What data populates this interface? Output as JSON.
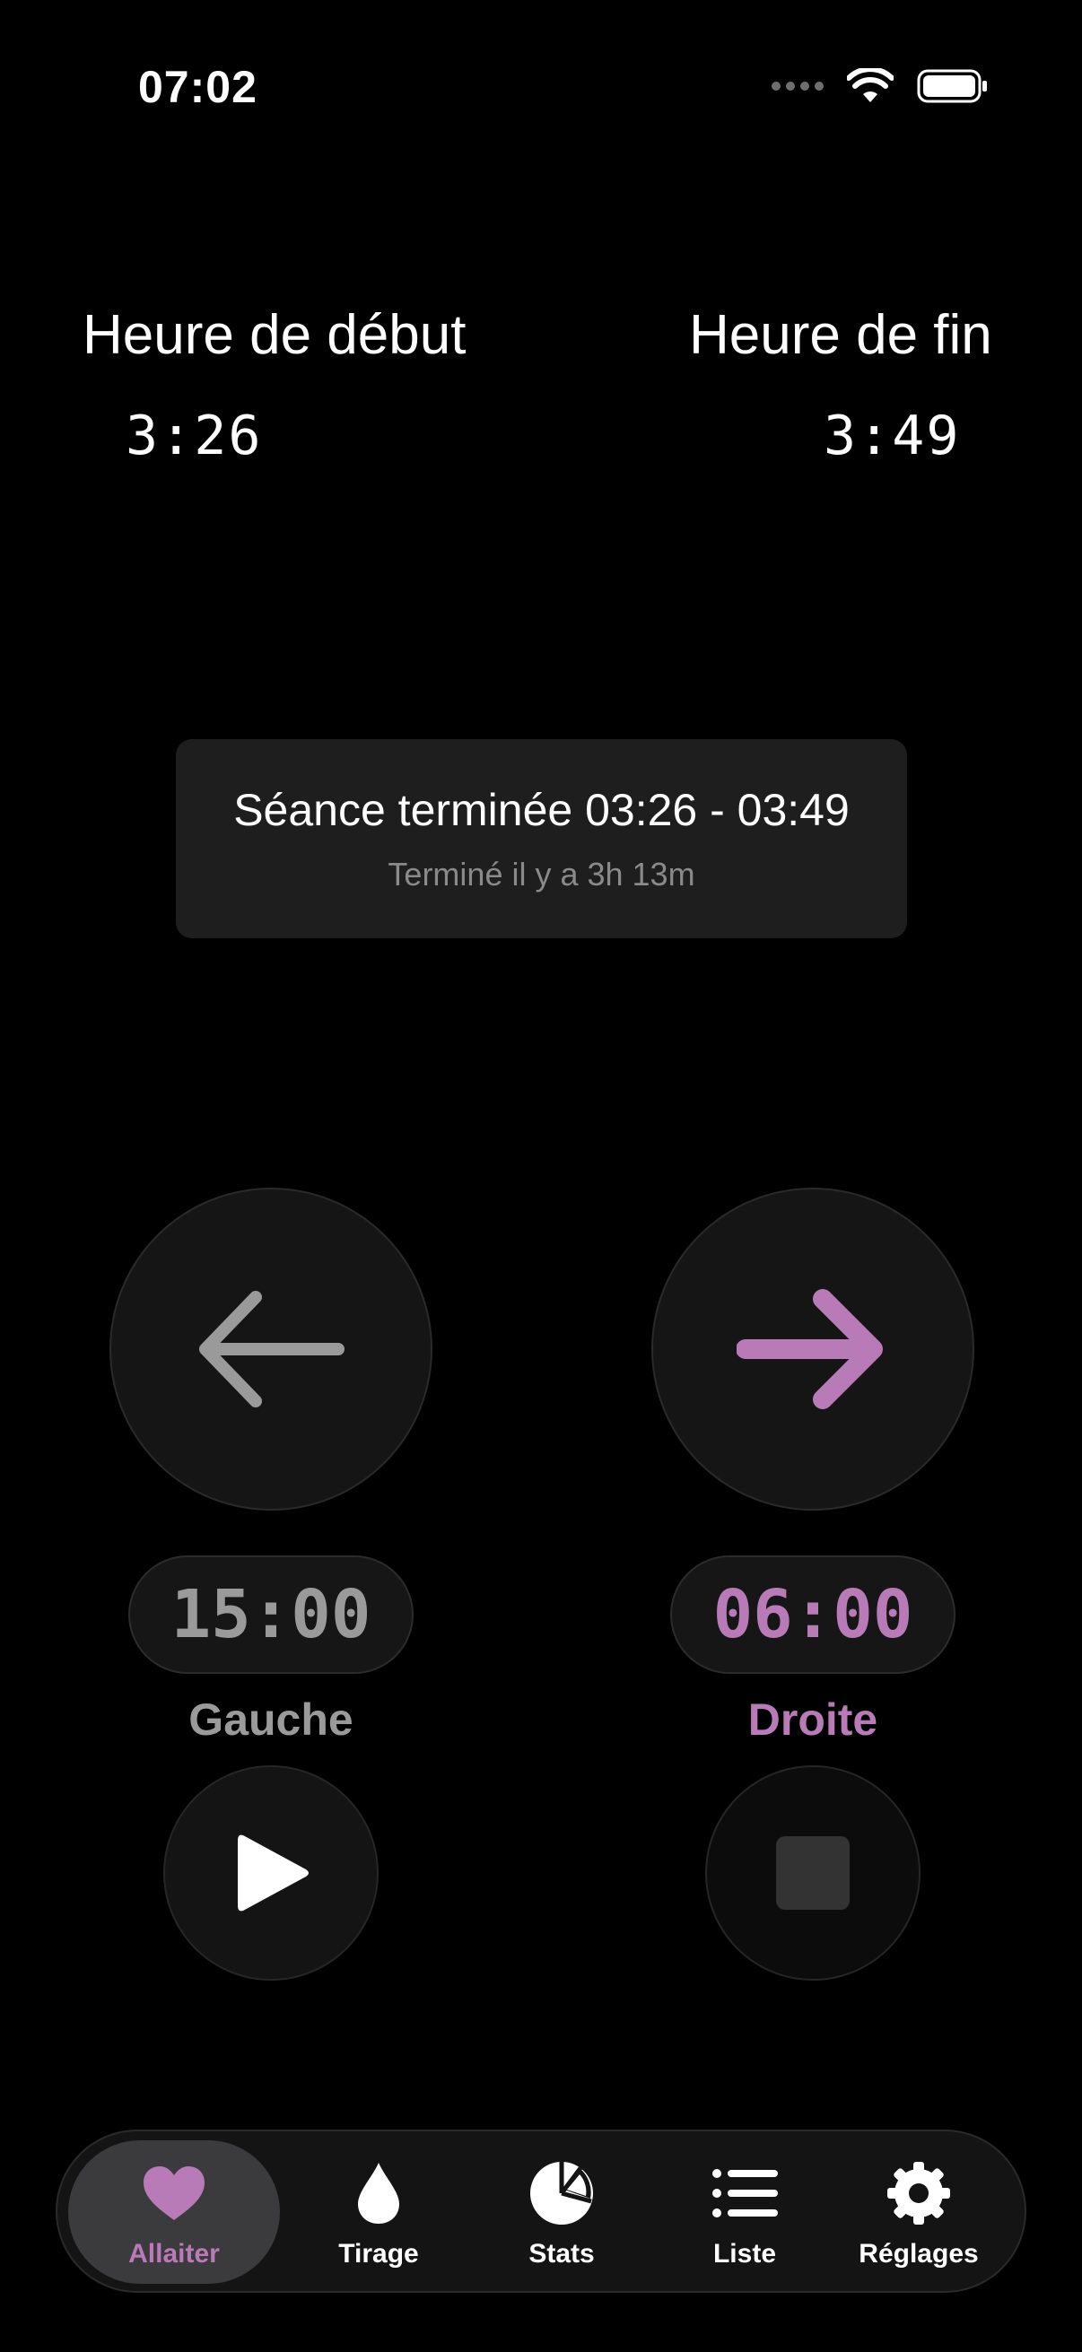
{
  "status_bar": {
    "time": "07:02"
  },
  "times": {
    "start_label": "Heure de début",
    "start_value": "3:26",
    "end_label": "Heure de fin",
    "end_value": "3:49"
  },
  "session": {
    "title": "Séance terminée 03:26 - 03:49",
    "subtitle": "Terminé il y a 3h 13m"
  },
  "left_side": {
    "timer": "15:00",
    "label": "Gauche",
    "color": "#9a9a9a"
  },
  "right_side": {
    "timer": "06:00",
    "label": "Droite",
    "color": "#b97ab8"
  },
  "tabs": [
    {
      "label": "Allaiter",
      "icon": "heart-icon",
      "active": true
    },
    {
      "label": "Tirage",
      "icon": "drop-icon"
    },
    {
      "label": "Stats",
      "icon": "pie-chart-icon"
    },
    {
      "label": "Liste",
      "icon": "list-icon"
    },
    {
      "label": "Réglages",
      "icon": "gear-icon"
    }
  ],
  "colors": {
    "accent": "#b97ab8",
    "background": "#000000"
  }
}
